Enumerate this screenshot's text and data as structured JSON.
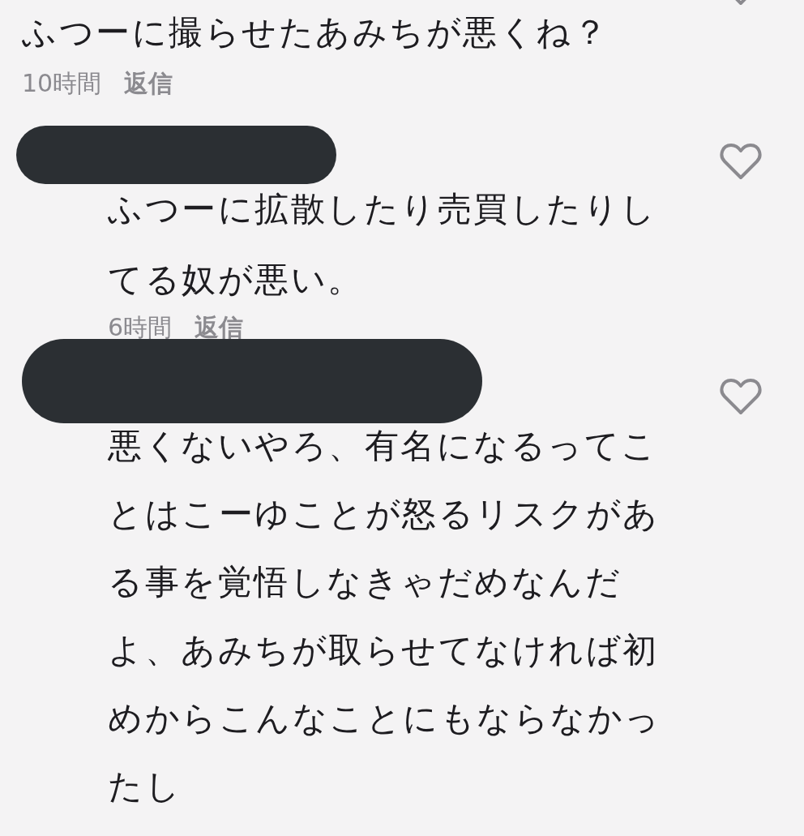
{
  "comment": {
    "text": "ふつーに撮らせたあみちが悪くね？",
    "time": "10時間",
    "reply_label": "返信"
  },
  "replies": [
    {
      "text": "ふつーに拡散したり売買したりしてる奴が悪い。",
      "time": "6時間",
      "reply_label": "返信"
    },
    {
      "text": "悪くないやろ、有名になるってことはこーゆことが怒るリスクがある事を覚悟しなきゃだめなんだよ、あみちが取らせてなければ初めからこんなことにもならなかったし"
    }
  ]
}
